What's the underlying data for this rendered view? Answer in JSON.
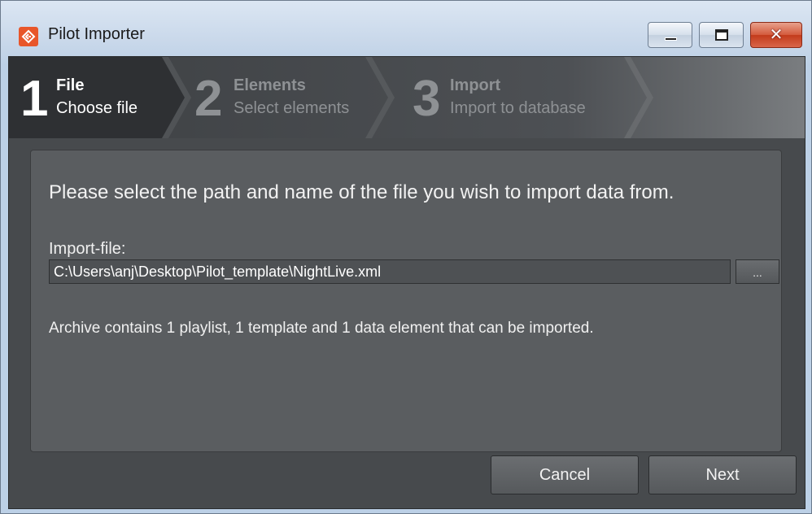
{
  "window": {
    "title": "Pilot Importer",
    "icon": "pilot-app-icon",
    "controls": {
      "minimize_icon": "minimize-icon",
      "maximize_icon": "maximize-icon",
      "close_icon": "close-icon",
      "close_glyph": "✕"
    }
  },
  "wizard": {
    "steps": [
      {
        "number": "1",
        "title": "File",
        "subtitle": "Choose file",
        "active": true
      },
      {
        "number": "2",
        "title": "Elements",
        "subtitle": "Select elements",
        "active": false
      },
      {
        "number": "3",
        "title": "Import",
        "subtitle": "Import to database",
        "active": false
      }
    ]
  },
  "panel": {
    "instruction": "Please select the path and name of the file you wish to import data from.",
    "file_label": "Import-file:",
    "file_value": "C:\\Users\\anj\\Desktop\\Pilot_template\\NightLive.xml",
    "browse_label": "...",
    "info": "Archive contains 1 playlist, 1 template and 1 data element that can be imported."
  },
  "footer": {
    "cancel_label": "Cancel",
    "next_label": "Next"
  },
  "colors": {
    "accent": "#e8562a",
    "background": "#474a4d",
    "panel": "#5a5d60"
  }
}
